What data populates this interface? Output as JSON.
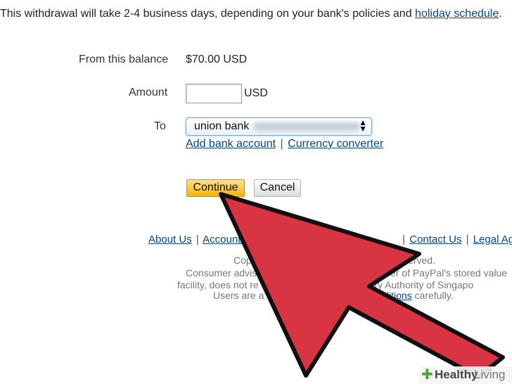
{
  "notice": {
    "text": "This withdrawal will take 2-4 business days, depending on your bank's policies and ",
    "link": "holiday schedule",
    "end": "."
  },
  "form": {
    "balance_label": "From this balance",
    "balance_value": "$70.00 USD",
    "amount_label": "Amount",
    "amount_value": "",
    "amount_currency": "USD",
    "to_label": "To",
    "to_selected": "union bank",
    "add_bank_link": "Add bank account",
    "link_sep": "|",
    "currency_link": "Currency converter"
  },
  "buttons": {
    "continue": "Continue",
    "cancel": "Cancel"
  },
  "footer": {
    "links": [
      "About Us",
      "Accounts",
      "Contact Us",
      "Legal Agr"
    ],
    "sep": "|",
    "copyright_tail": "s reserved.",
    "line2_left": "Consumer advis",
    "line2_right": "der of PayPal's stored value",
    "line3_left": "facility, does not re",
    "line3_right": "Monetary Authority of Singapo",
    "line4_left": "Users are a",
    "terms_link": "and conditions",
    "line4_right": " carefully.",
    "copy_left": "Cop"
  },
  "overlay": {
    "arrow_color": "#d93443",
    "arrow_outline": "#111111"
  },
  "brand": {
    "icon": "plus-icon",
    "word1": "Healthy",
    "word2": "Living"
  }
}
